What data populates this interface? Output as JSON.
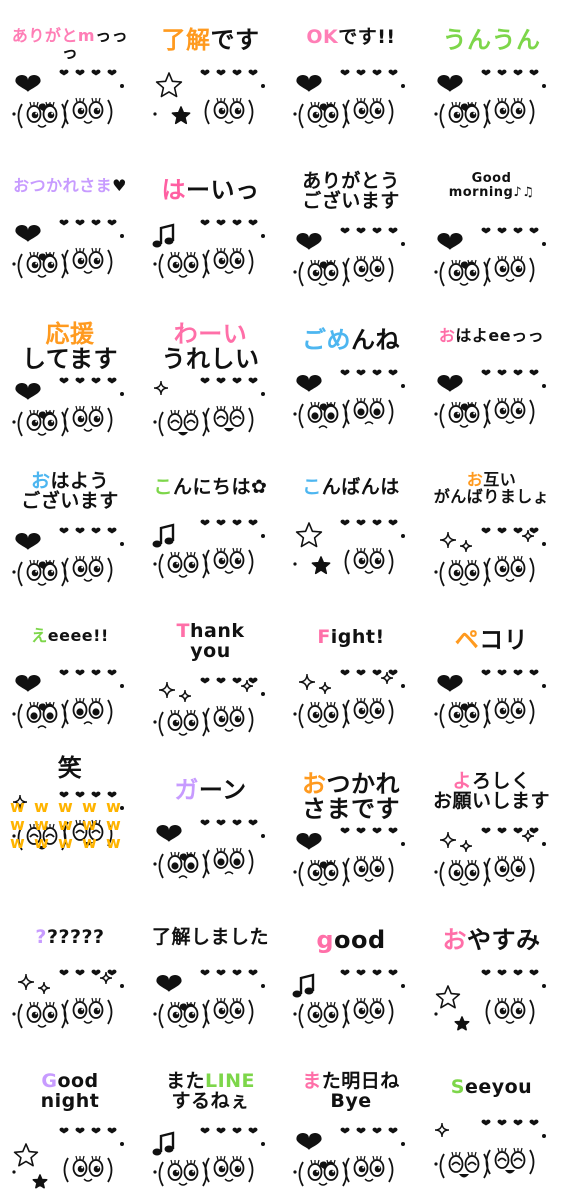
{
  "stickers": [
    {
      "accent": "#ff7eb6",
      "words": [
        {
          "t": "ありがとm",
          "c": "#ff7eb6"
        },
        {
          "t": "っっっ",
          "c": "#111"
        }
      ],
      "art": "heart-faces"
    },
    {
      "accent": "#ff9a1f",
      "words": [
        {
          "t": "了解",
          "c": "#ff9a1f"
        },
        {
          "t": "です",
          "c": "#111"
        }
      ],
      "art": "star-faces"
    },
    {
      "accent": "#ff7eb6",
      "words": [
        {
          "t": "OK",
          "c": "#ff7eb6"
        },
        {
          "t": "です!!",
          "c": "#111"
        }
      ],
      "art": "heart-faces"
    },
    {
      "accent": "#7dd64a",
      "words": [
        {
          "t": "うんうん",
          "c": "#7dd64a"
        }
      ],
      "art": "nod-faces"
    },
    {
      "accent": "#c79bff",
      "words": [
        {
          "t": "おつかれさま",
          "c": "#c79bff"
        },
        {
          "t": "♥",
          "c": "#111"
        }
      ],
      "art": "heart-faces"
    },
    {
      "accent": "#ff5fa2",
      "words": [
        {
          "t": "は",
          "c": "#ff5fa2"
        },
        {
          "t": "ーいっ",
          "c": "#111"
        }
      ],
      "art": "note-faces"
    },
    {
      "accent": "#111",
      "words": [
        {
          "t": "ありがとう\nございます",
          "c": "#111"
        }
      ],
      "art": "heart-faces"
    },
    {
      "accent": "#ff7eb6",
      "words": [
        {
          "t": "Good\nmorning",
          "c": "#111"
        },
        {
          "t": "♪♫",
          "c": "#111"
        }
      ],
      "art": "heart-faces"
    },
    {
      "accent": "#ff9a1f",
      "words": [
        {
          "t": "応援",
          "c": "#ff9a1f"
        },
        {
          "t": "\nしてます",
          "c": "#111"
        }
      ],
      "art": "cheer-faces"
    },
    {
      "accent": "#ff6fa8",
      "words": [
        {
          "t": "わーい",
          "c": "#ff6fa8"
        },
        {
          "t": "\nうれしい",
          "c": "#111"
        }
      ],
      "art": "happy-faces"
    },
    {
      "accent": "#4db6f0",
      "words": [
        {
          "t": "ごめ",
          "c": "#4db6f0"
        },
        {
          "t": "んね",
          "c": "#111"
        }
      ],
      "art": "sorry-faces"
    },
    {
      "accent": "#ff6fa8",
      "words": [
        {
          "t": "お",
          "c": "#ff6fa8"
        },
        {
          "t": "はよ",
          "c": "#111"
        },
        {
          "t": "ee",
          "c": "#111"
        },
        {
          "t": "っっ",
          "c": "#111"
        }
      ],
      "art": "heart-faces"
    },
    {
      "accent": "#4db6f0",
      "words": [
        {
          "t": "お",
          "c": "#4db6f0"
        },
        {
          "t": "はよう\nございます",
          "c": "#111"
        }
      ],
      "art": "heart-faces"
    },
    {
      "accent": "#7dd64a",
      "words": [
        {
          "t": "こ",
          "c": "#7dd64a"
        },
        {
          "t": "んにちは",
          "c": "#111"
        },
        {
          "t": "✿",
          "c": "#111"
        }
      ],
      "art": "note-faces"
    },
    {
      "accent": "#4db6f0",
      "words": [
        {
          "t": "こ",
          "c": "#4db6f0"
        },
        {
          "t": "んばんは",
          "c": "#111"
        }
      ],
      "art": "star-faces"
    },
    {
      "accent": "#ff9a1f",
      "words": [
        {
          "t": "お",
          "c": "#ff9a1f"
        },
        {
          "t": "互い\nがんばりましょ",
          "c": "#111"
        }
      ],
      "art": "sparkle-faces"
    },
    {
      "accent": "#7dd64a",
      "words": [
        {
          "t": "え",
          "c": "#7dd64a"
        },
        {
          "t": "eeee!!",
          "c": "#111"
        }
      ],
      "art": "shock-faces"
    },
    {
      "accent": "#ff6fa8",
      "words": [
        {
          "t": "T",
          "c": "#ff6fa8"
        },
        {
          "t": "hank\nyou",
          "c": "#111"
        }
      ],
      "art": "sparkle-faces"
    },
    {
      "accent": "#ff6fa8",
      "words": [
        {
          "t": "F",
          "c": "#ff6fa8"
        },
        {
          "t": "ight!",
          "c": "#111"
        }
      ],
      "art": "sparkle-faces"
    },
    {
      "accent": "#ff9a1f",
      "words": [
        {
          "t": "ペ",
          "c": "#ff9a1f"
        },
        {
          "t": "コリ",
          "c": "#111"
        }
      ],
      "art": "heart-faces"
    },
    {
      "accent": "#ffb400",
      "words": [
        {
          "t": "笑",
          "c": "#111"
        }
      ],
      "art": "laugh-faces"
    },
    {
      "accent": "#c79bff",
      "words": [
        {
          "t": "ガ",
          "c": "#c79bff"
        },
        {
          "t": "ーン",
          "c": "#111"
        }
      ],
      "art": "cry-faces"
    },
    {
      "accent": "#ff9a1f",
      "words": [
        {
          "t": "お",
          "c": "#ff9a1f"
        },
        {
          "t": "つかれ\nさまです",
          "c": "#111"
        }
      ],
      "art": "heart-faces"
    },
    {
      "accent": "#ff6fa8",
      "words": [
        {
          "t": "よ",
          "c": "#ff6fa8"
        },
        {
          "t": "ろしく\nお願いします",
          "c": "#111"
        }
      ],
      "art": "sparkle-faces"
    },
    {
      "accent": "#c79bff",
      "words": [
        {
          "t": "?",
          "c": "#c79bff"
        },
        {
          "t": "?????",
          "c": "#111"
        }
      ],
      "art": "question-faces"
    },
    {
      "accent": "#ff7eb6",
      "words": [
        {
          "t": "了解",
          "c": "#111"
        },
        {
          "t": "しました",
          "c": "#111"
        }
      ],
      "art": "heart-faces"
    },
    {
      "accent": "#ff6fa8",
      "words": [
        {
          "t": "g",
          "c": "#ff6fa8"
        },
        {
          "t": "ood",
          "c": "#111"
        }
      ],
      "art": "note-faces"
    },
    {
      "accent": "#ff6fa8",
      "words": [
        {
          "t": "お",
          "c": "#ff6fa8"
        },
        {
          "t": "やすみ",
          "c": "#111"
        }
      ],
      "art": "sleep-faces"
    },
    {
      "accent": "#c79bff",
      "words": [
        {
          "t": "G",
          "c": "#c79bff"
        },
        {
          "t": "ood\nnight",
          "c": "#111"
        }
      ],
      "art": "sleep-faces"
    },
    {
      "accent": "#7dd64a",
      "words": [
        {
          "t": "また",
          "c": "#111"
        },
        {
          "t": "LINE",
          "c": "#7dd64a"
        },
        {
          "t": "\nするねぇ",
          "c": "#111"
        }
      ],
      "art": "note-faces"
    },
    {
      "accent": "#ff6fa8",
      "words": [
        {
          "t": "ま",
          "c": "#ff6fa8"
        },
        {
          "t": "た明日ね",
          "c": "#111"
        },
        {
          "t": "\nBye",
          "c": "#111"
        }
      ],
      "art": "heart-faces"
    },
    {
      "accent": "#7dd64a",
      "words": [
        {
          "t": "S",
          "c": "#7dd64a"
        },
        {
          "t": "eeyou",
          "c": "#111"
        }
      ],
      "art": "laugh-faces"
    }
  ]
}
